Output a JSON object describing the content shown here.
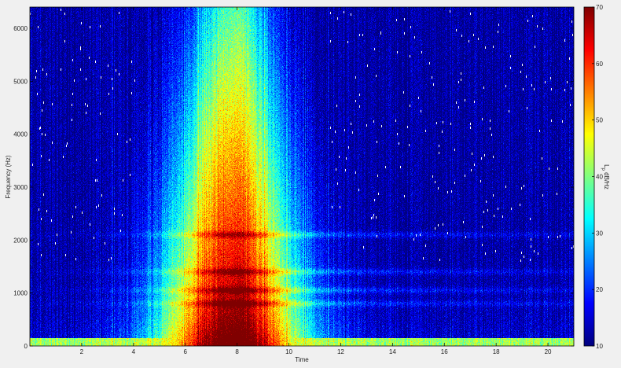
{
  "chart_data": {
    "type": "heatmap",
    "title": "",
    "xlabel": "Time",
    "ylabel": "Frequency (Hz)",
    "xlim": [
      0,
      21
    ],
    "ylim": [
      0,
      6400
    ],
    "x_ticks": [
      2,
      4,
      6,
      8,
      10,
      12,
      14,
      16,
      18,
      20
    ],
    "x_tick_labels": [
      "2",
      "4",
      "6",
      "8",
      "10",
      "12",
      "14",
      "16",
      "18",
      "20"
    ],
    "y_ticks": [
      0,
      1000,
      2000,
      3000,
      4000,
      5000,
      6000
    ],
    "y_tick_labels": [
      "0",
      "1000",
      "2000",
      "3000",
      "4000",
      "5000",
      "6000"
    ],
    "colormap": "jet",
    "colorbar": {
      "label": "L_p dB/Hz",
      "label_main": "L",
      "label_sub": "p",
      "label_unit": " dB/Hz",
      "range": [
        10,
        70
      ],
      "ticks": [
        10,
        20,
        30,
        40,
        50,
        60,
        70
      ],
      "tick_labels": [
        "10",
        "20",
        "30",
        "40",
        "50",
        "60",
        "70"
      ]
    },
    "approx_structure": {
      "background_level_db": 12,
      "event_start_time": 4.8,
      "event_peak_time": 7.8,
      "event_end_time": 10.5,
      "event_peak_db": 68,
      "event_top_frequency": 6400,
      "low_frequency_band_hz": [
        0,
        150
      ],
      "low_frequency_band_db": 42,
      "harmonic_bands_hz": [
        800,
        1050,
        1400,
        2100
      ],
      "harmonic_band_db": 26
    },
    "grid": false
  }
}
